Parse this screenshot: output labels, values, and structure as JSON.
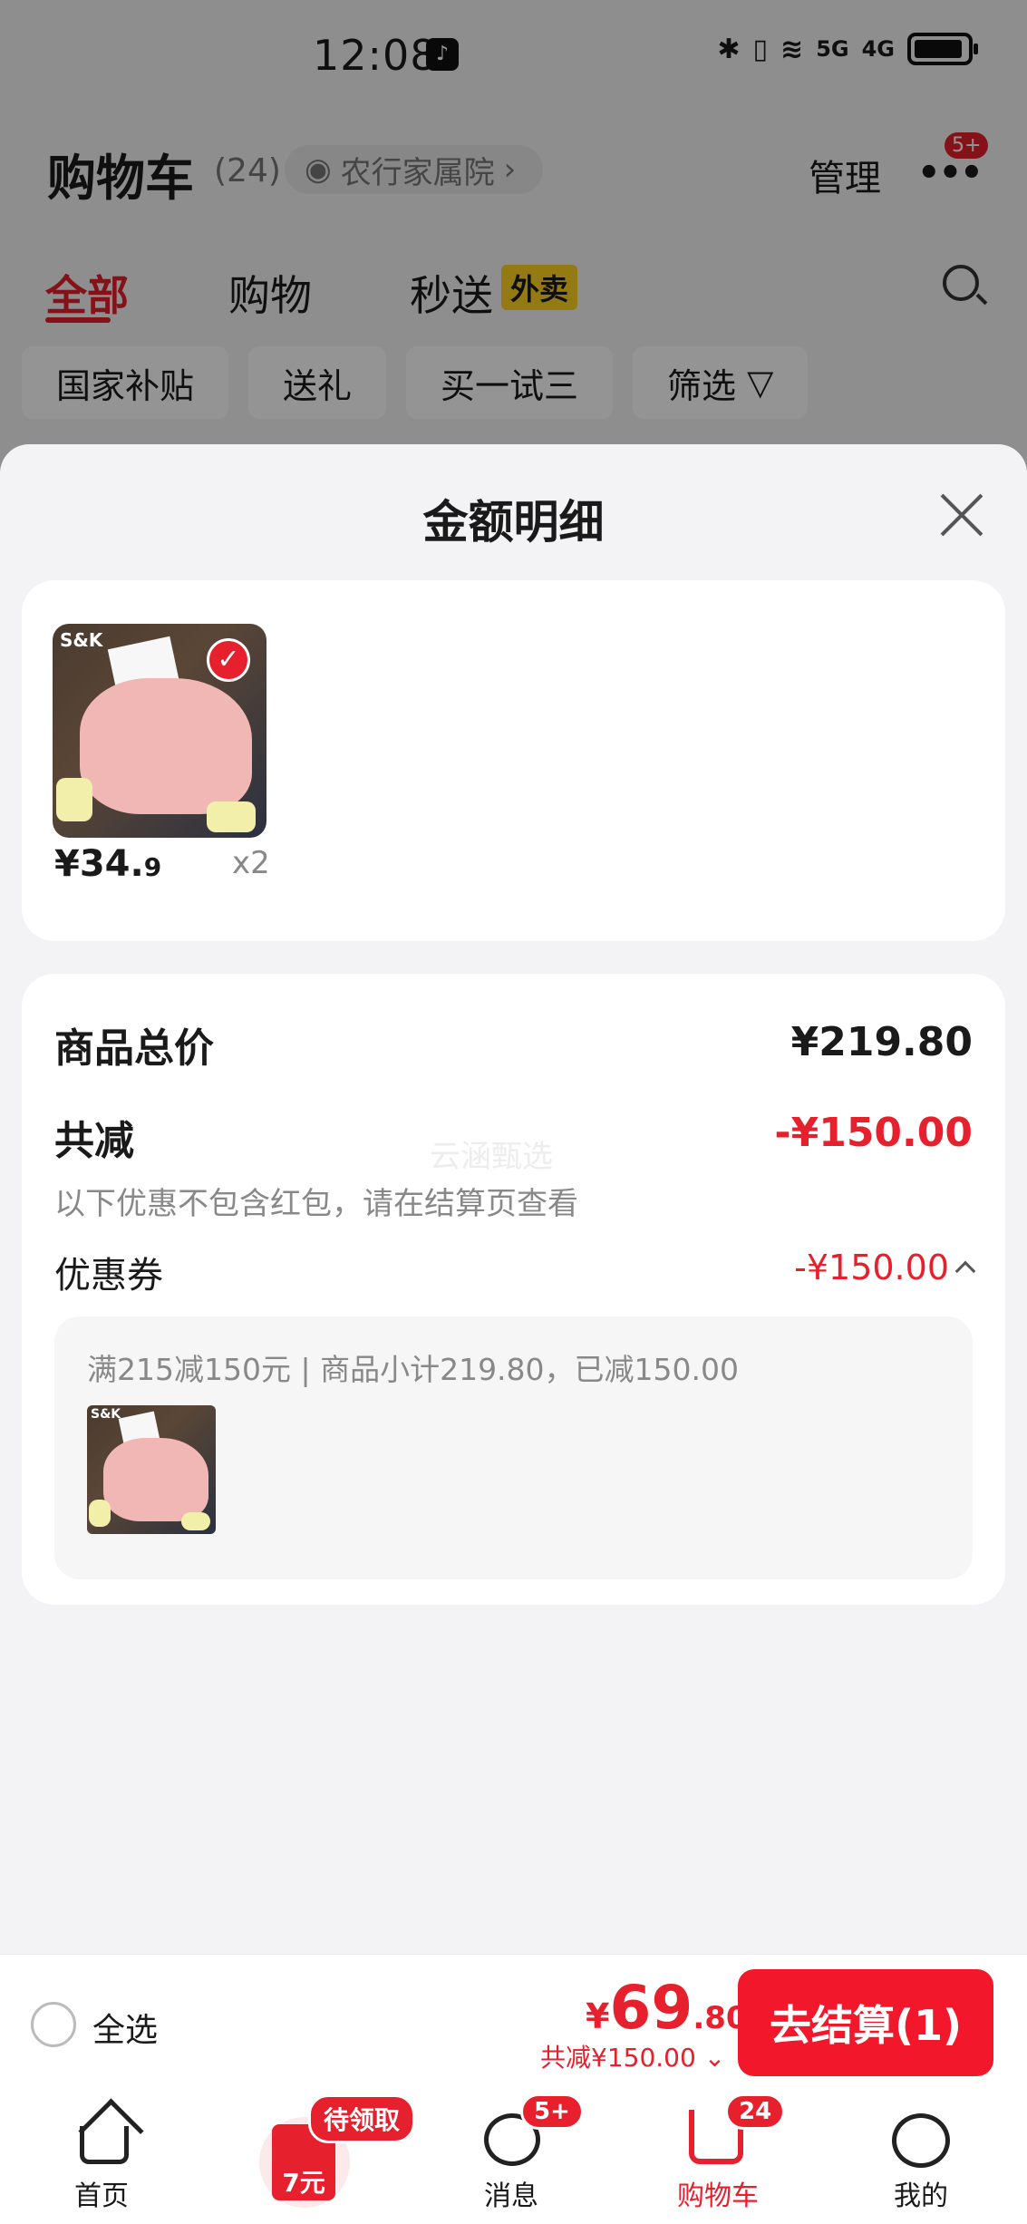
{
  "status_bar": {
    "time": "12:08",
    "signal_5g": "5G",
    "signal_4g": "4G"
  },
  "header": {
    "title": "购物车",
    "count": "(24)",
    "address": "农行家属院",
    "manage": "管理",
    "more_badge": "5+"
  },
  "tabs": [
    {
      "label": "全部"
    },
    {
      "label": "购物"
    },
    {
      "label": "秒送"
    }
  ],
  "tab_tag": "外卖",
  "chips": [
    {
      "label": "国家补贴"
    },
    {
      "label": "送礼"
    },
    {
      "label": "买一试三"
    },
    {
      "label": "筛选"
    }
  ],
  "sheet": {
    "title": "金额明细",
    "item": {
      "brand": "S&K",
      "price_int": "¥34.",
      "price_dec": "9",
      "qty": "x2"
    },
    "total_label": "商品总价",
    "total_value": "¥219.80",
    "discount_label": "共减",
    "discount_value": "-¥150.00",
    "note": "以下优惠不包含红包，请在结算页查看",
    "coupon_label": "优惠券",
    "coupon_value": "-¥150.00",
    "coupon_detail": "满215减150元 | 商品小计219.80，已减150.00",
    "watermark": "云涵甄选"
  },
  "bottom_bar": {
    "select_all": "全选",
    "yen": "¥",
    "total_int": "69",
    "total_dec": ".80",
    "saved": "共减¥150.00",
    "checkout": "去结算(1)"
  },
  "tabbar": {
    "home": "首页",
    "pending": "待领取",
    "red_packet_text": "7元",
    "messages": "消息",
    "messages_badge": "5+",
    "cart": "购物车",
    "cart_badge": "24",
    "me": "我的"
  },
  "colors": {
    "accent": "#e6202c",
    "tag_yellow": "#ffd21f",
    "checkout_bg": "#f2172b"
  }
}
